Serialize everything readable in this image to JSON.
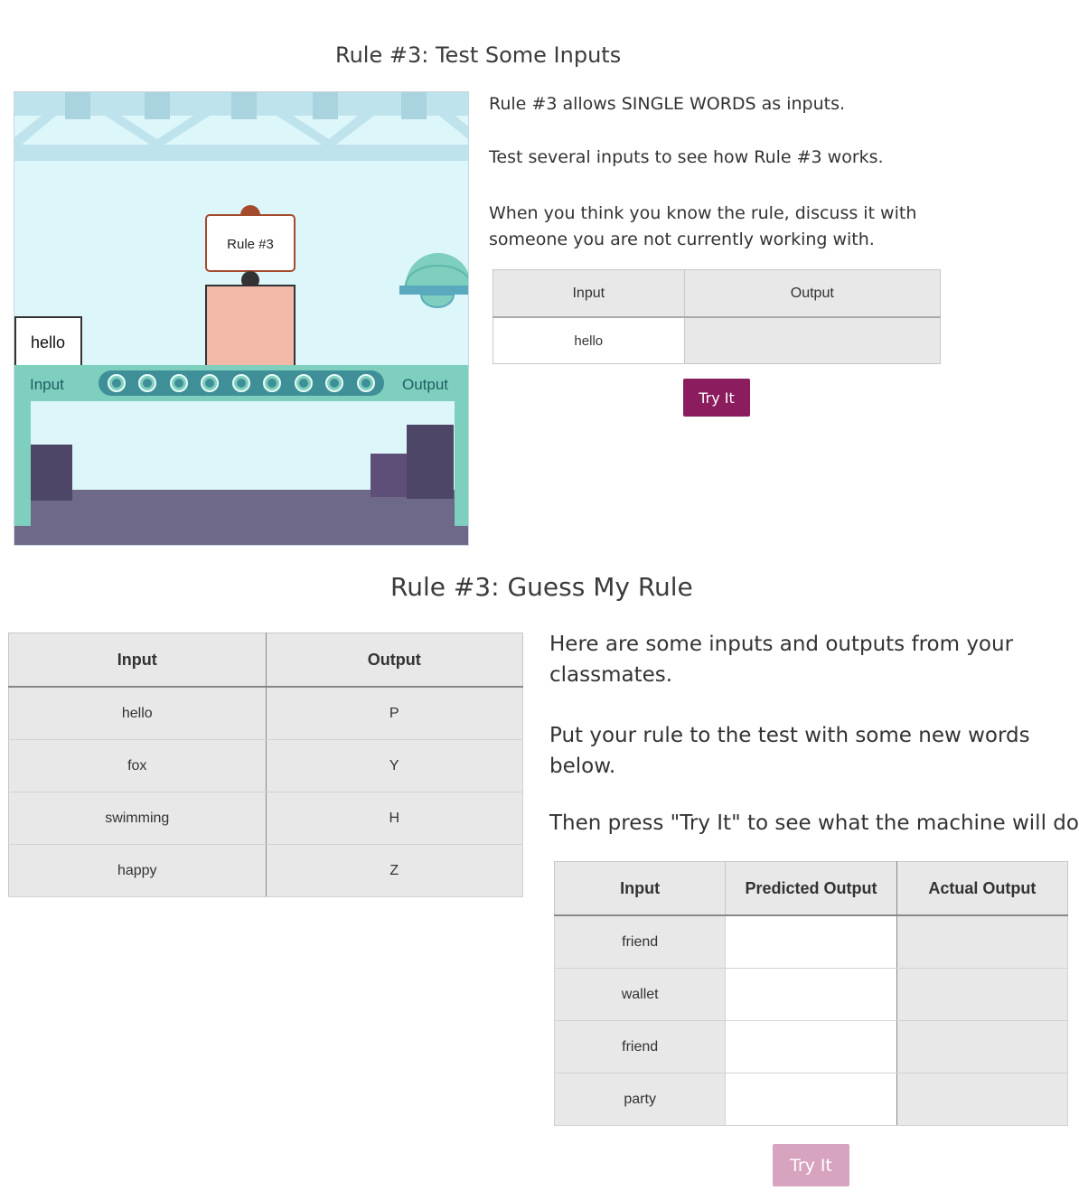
{
  "section1": {
    "title": "Rule #3: Test Some Inputs",
    "machine": {
      "rule_sign": "Rule #3",
      "input_card": "hello",
      "input_label": "Input",
      "output_label": "Output",
      "colors": {
        "sky": "#dcf6fa",
        "belt": "#7ecfbd",
        "floor": "#6e6889",
        "box": "#f2b8a8",
        "accent": "#8b1d5e"
      }
    },
    "paragraphs": [
      "Rule #3 allows SINGLE WORDS as inputs.",
      "Test several inputs to see how Rule #3 works.",
      "When you think you know the rule, discuss it with someone you are not currently working with."
    ],
    "table": {
      "headers": [
        "Input",
        "Output"
      ],
      "rows": [
        {
          "input": "hello",
          "output": ""
        }
      ]
    },
    "try_button": "Try It"
  },
  "section2": {
    "title": "Rule #3: Guess My Rule",
    "classmates_table": {
      "headers": [
        "Input",
        "Output"
      ],
      "rows": [
        {
          "input": "hello",
          "output": "P"
        },
        {
          "input": "fox",
          "output": "Y"
        },
        {
          "input": "swimming",
          "output": "H"
        },
        {
          "input": "happy",
          "output": "Z"
        }
      ]
    },
    "paragraphs": [
      "Here are some inputs and outputs from your classmates.",
      "Put your rule to the test with some new words below.",
      "Then press \"Try It\" to see what the machine will do."
    ],
    "predict_table": {
      "headers": [
        "Input",
        "Predicted Output",
        "Actual Output"
      ],
      "rows": [
        {
          "input": "friend",
          "predicted": "",
          "actual": ""
        },
        {
          "input": "wallet",
          "predicted": "",
          "actual": ""
        },
        {
          "input": "friend",
          "predicted": "",
          "actual": ""
        },
        {
          "input": "party",
          "predicted": "",
          "actual": ""
        }
      ]
    },
    "try_button": "Try It"
  }
}
